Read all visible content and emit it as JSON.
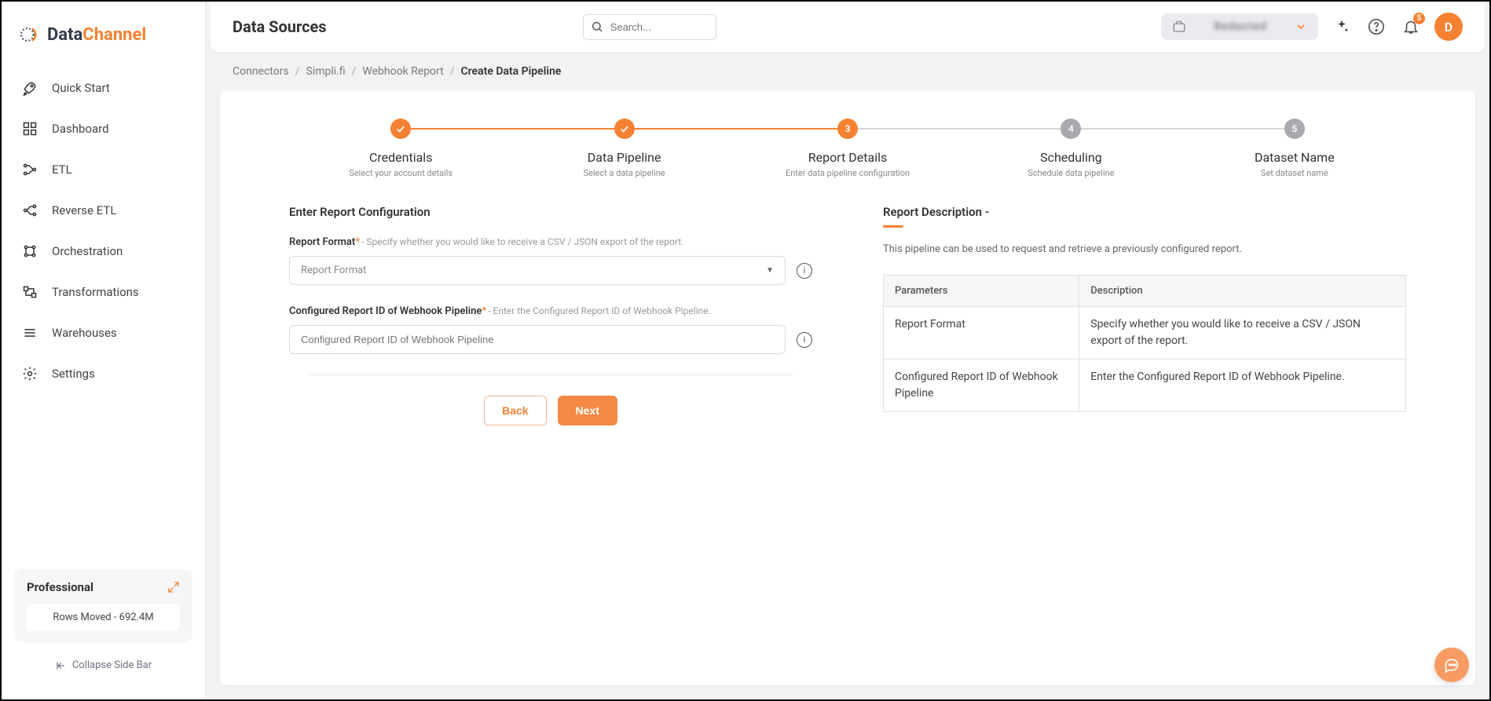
{
  "logo": {
    "part1": "Data",
    "part2": "Channel"
  },
  "sidebar": {
    "items": [
      {
        "label": "Quick Start"
      },
      {
        "label": "Dashboard"
      },
      {
        "label": "ETL"
      },
      {
        "label": "Reverse ETL"
      },
      {
        "label": "Orchestration"
      },
      {
        "label": "Transformations"
      },
      {
        "label": "Warehouses"
      },
      {
        "label": "Settings"
      }
    ],
    "plan": {
      "name": "Professional",
      "rows_moved_label": "Rows Moved - 692.4M"
    },
    "collapse_label": "Collapse Side Bar"
  },
  "header": {
    "title": "Data Sources",
    "search_placeholder": "Search...",
    "org_name": "Redacted",
    "notification_count": "5",
    "avatar_initial": "D"
  },
  "breadcrumb": [
    {
      "label": "Connectors",
      "active": false
    },
    {
      "label": "Simpli.fi",
      "active": false
    },
    {
      "label": "Webhook Report",
      "active": false
    },
    {
      "label": "Create Data Pipeline",
      "active": true
    }
  ],
  "stepper": [
    {
      "title": "Credentials",
      "sub": "Select your account details",
      "state": "done"
    },
    {
      "title": "Data Pipeline",
      "sub": "Select a data pipeline",
      "state": "done"
    },
    {
      "title": "Report Details",
      "sub": "Enter data pipeline configuration",
      "state": "active",
      "num": "3"
    },
    {
      "title": "Scheduling",
      "sub": "Schedule data pipeline",
      "state": "pending",
      "num": "4"
    },
    {
      "title": "Dataset Name",
      "sub": "Set dataset name",
      "state": "pending",
      "num": "5"
    }
  ],
  "form": {
    "section_title": "Enter Report Configuration",
    "report_format": {
      "label": "Report Format",
      "required_mark": "*",
      "hint": "- Specify whether you would like to receive a CSV / JSON export of the report.",
      "placeholder": "Report Format"
    },
    "configured_id": {
      "label": "Configured Report ID of Webhook Pipeline",
      "required_mark": "*",
      "hint": "- Enter the Configured Report ID of Webhook Pipeline.",
      "placeholder": "Configured Report ID of Webhook Pipeline"
    },
    "back_label": "Back",
    "next_label": "Next"
  },
  "description": {
    "title": "Report Description -",
    "text": "This pipeline can be used to request and retrieve a previously configured report.",
    "table": {
      "headers": {
        "param": "Parameters",
        "desc": "Description"
      },
      "rows": [
        {
          "param": "Report Format",
          "desc": "Specify whether you would like to receive a CSV / JSON export of the report."
        },
        {
          "param": "Configured Report ID of Webhook Pipeline",
          "desc": "Enter the Configured Report ID of Webhook Pipeline."
        }
      ]
    }
  }
}
